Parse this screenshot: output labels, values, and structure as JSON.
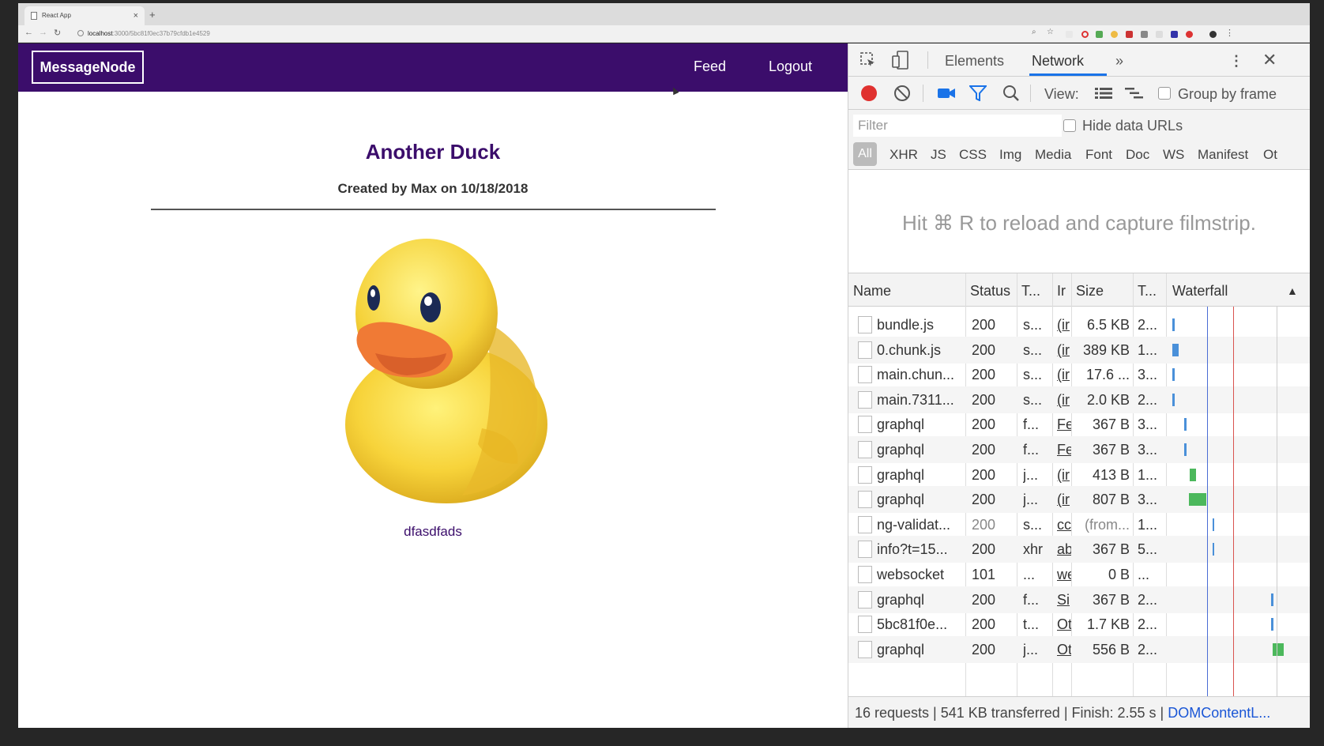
{
  "browser": {
    "tab_title": "React App",
    "url_host": "localhost",
    "url_path": ":3000/5bc81f0ec37b79cfdb1e4529"
  },
  "app": {
    "logo": "MessageNode",
    "nav": {
      "feed": "Feed",
      "logout": "Logout"
    },
    "post": {
      "title": "Another Duck",
      "meta": "Created by Max on 10/18/2018",
      "content": "dfasdfads"
    },
    "colors": {
      "primary": "#3b0d6b"
    }
  },
  "devtools": {
    "tabs": {
      "elements": "Elements",
      "network": "Network",
      "more": "»"
    },
    "toolbar": {
      "view_label": "View:",
      "group_by_frame": "Group by frame"
    },
    "filter": {
      "placeholder": "Filter",
      "hide_data_urls": "Hide data URLs"
    },
    "types": {
      "all": "All",
      "xhr": "XHR",
      "js": "JS",
      "css": "CSS",
      "img": "Img",
      "media": "Media",
      "font": "Font",
      "doc": "Doc",
      "ws": "WS",
      "manifest": "Manifest",
      "other": "Ot"
    },
    "filmstrip_hint": "Hit ⌘ R to reload and capture filmstrip.",
    "columns": {
      "name": "Name",
      "status": "Status",
      "type": "T...",
      "initiator": "Ir",
      "size": "Size",
      "time": "T...",
      "waterfall": "Waterfall"
    },
    "rows": [
      {
        "name": "bundle.js",
        "status": "200",
        "type": "s...",
        "initiator": "(ir",
        "size": "6.5 KB",
        "time": "2..."
      },
      {
        "name": "0.chunk.js",
        "status": "200",
        "type": "s...",
        "initiator": "(ir",
        "size": "389 KB",
        "time": "1..."
      },
      {
        "name": "main.chun...",
        "status": "200",
        "type": "s...",
        "initiator": "(ir",
        "size": "17.6 ...",
        "time": "3..."
      },
      {
        "name": "main.7311...",
        "status": "200",
        "type": "s...",
        "initiator": "(ir",
        "size": "2.0 KB",
        "time": "2..."
      },
      {
        "name": "graphql",
        "status": "200",
        "type": "f...",
        "initiator": "Fe",
        "size": "367 B",
        "time": "3..."
      },
      {
        "name": "graphql",
        "status": "200",
        "type": "f...",
        "initiator": "Fe",
        "size": "367 B",
        "time": "3..."
      },
      {
        "name": "graphql",
        "status": "200",
        "type": "j...",
        "initiator": "(ir",
        "size": "413 B",
        "time": "1..."
      },
      {
        "name": "graphql",
        "status": "200",
        "type": "j...",
        "initiator": "(ir",
        "size": "807 B",
        "time": "3..."
      },
      {
        "name": "ng-validat...",
        "status": "200",
        "type": "s...",
        "initiator": "cc",
        "size": "(from...",
        "time": "1..."
      },
      {
        "name": "info?t=15...",
        "status": "200",
        "type": "xhr",
        "initiator": "ab",
        "size": "367 B",
        "time": "5..."
      },
      {
        "name": "websocket",
        "status": "101",
        "type": "...",
        "initiator": "we",
        "size": "0 B",
        "time": "..."
      },
      {
        "name": "graphql",
        "status": "200",
        "type": "f...",
        "initiator": "Si",
        "size": "367 B",
        "time": "2..."
      },
      {
        "name": "5bc81f0e...",
        "status": "200",
        "type": "t...",
        "initiator": "Ot",
        "size": "1.7 KB",
        "time": "2..."
      },
      {
        "name": "graphql",
        "status": "200",
        "type": "j...",
        "initiator": "Ot",
        "size": "556 B",
        "time": "2..."
      }
    ],
    "status_bar": {
      "summary": "16 requests | 541 KB transferred | Finish: 2.55 s | ",
      "dom_content": "DOMContentL..."
    },
    "colors": {
      "accent": "#1a73e8",
      "record": "#e0312f",
      "bar_blue": "#4a90d9",
      "bar_green": "#4cb85c"
    }
  }
}
